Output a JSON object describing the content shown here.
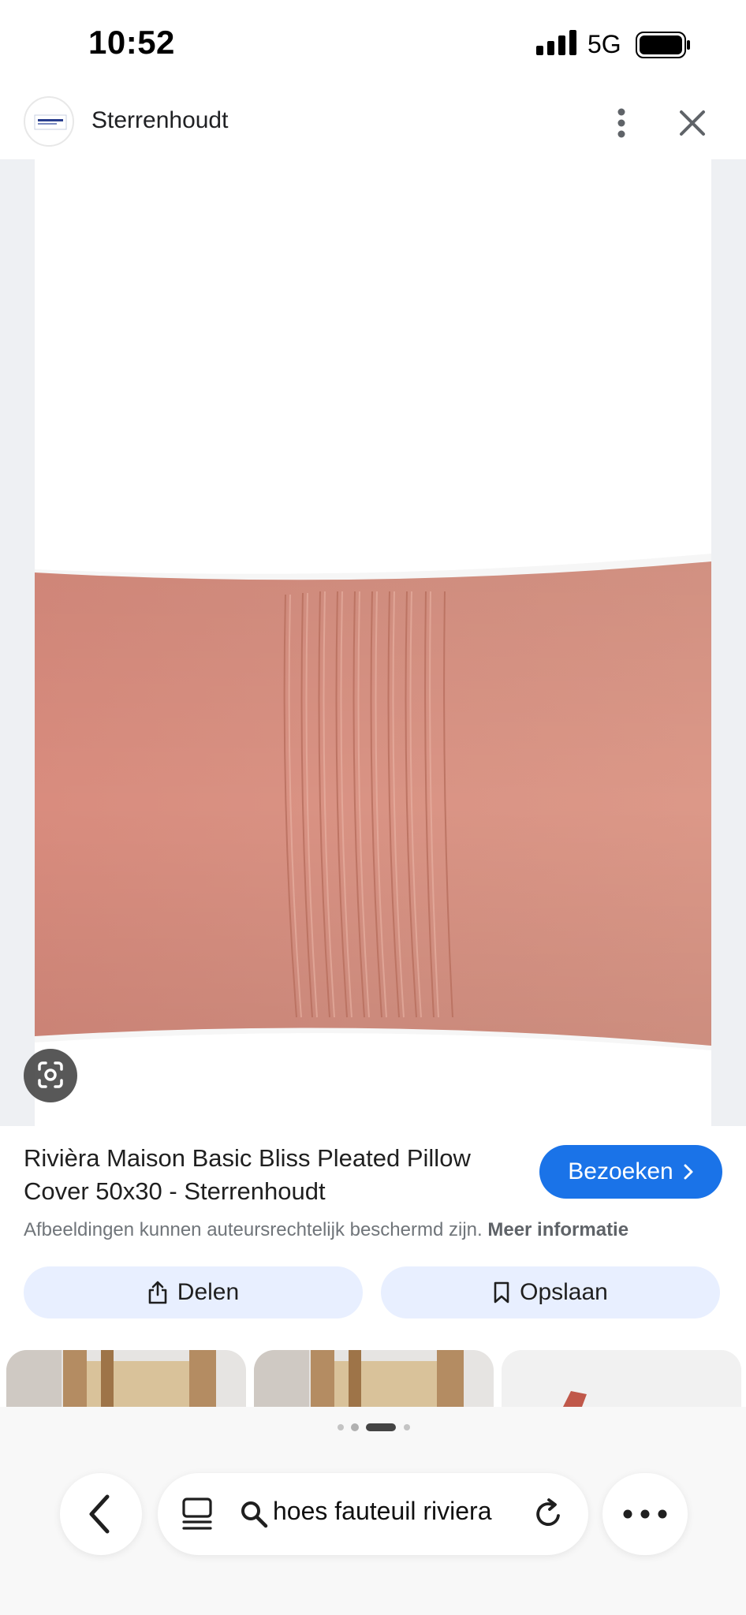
{
  "status_bar": {
    "time": "10:52",
    "network": "5G"
  },
  "header": {
    "site_name": "Sterrenhoudt",
    "more_icon": "more-vert-icon",
    "close_icon": "close-icon"
  },
  "image": {
    "description_icon": "lens-icon",
    "pillow_color": "#d98f80"
  },
  "result": {
    "title": "Rivièra Maison Basic Bliss Pleated Pillow Cover 50x30 - Sterrenhoudt",
    "visit_label": "Bezoeken",
    "copyright_text": "Afbeeldingen kunnen auteursrechtelijk beschermd zijn.",
    "more_info_label": "Meer informatie",
    "share_label": "Delen",
    "save_label": "Opslaan"
  },
  "browser_bar": {
    "url_text": "hoes fauteuil riviera",
    "accent_color": "#1a73e8"
  }
}
